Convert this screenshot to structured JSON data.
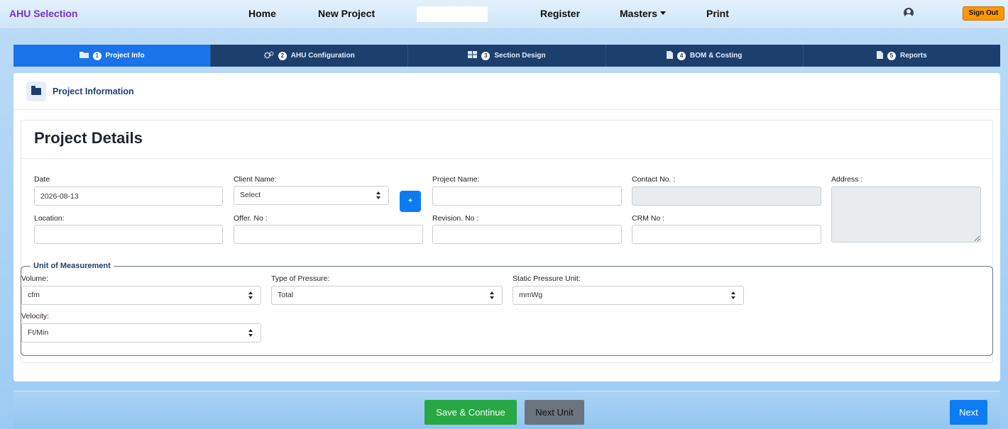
{
  "navbar": {
    "brand": "AHU Selection",
    "links": {
      "home": "Home",
      "new_project": "New Project",
      "register": "Register",
      "masters": "Masters",
      "print": "Print"
    },
    "sign_out": "Sign Out",
    "user_icon": "user-circle-icon"
  },
  "stepper": {
    "steps": [
      {
        "number": "1",
        "label": "Project Info",
        "icon": "folder-icon",
        "active": true
      },
      {
        "number": "2",
        "label": "AHU Configuration",
        "icon": "cogs-icon",
        "active": false
      },
      {
        "number": "3",
        "label": "Section Design",
        "icon": "grid-icon",
        "active": false
      },
      {
        "number": "4",
        "label": "BOM & Costing",
        "icon": "document-icon",
        "active": false
      },
      {
        "number": "5",
        "label": "Reports",
        "icon": "document-icon",
        "active": false
      }
    ]
  },
  "card": {
    "header_title": "Project Information",
    "details_title": "Project Details"
  },
  "form": {
    "date": {
      "label": "Date",
      "value": "2026-08-13"
    },
    "client_name": {
      "label": "Client Name:",
      "value": "Select"
    },
    "add_client_label": "+",
    "project_name": {
      "label": "Project Name:",
      "value": ""
    },
    "contact_no": {
      "label": "Contact No. :",
      "value": ""
    },
    "address": {
      "label": "Address :",
      "value": ""
    },
    "location": {
      "label": "Location:",
      "value": ""
    },
    "offer_no": {
      "label": "Offer. No :",
      "value": ""
    },
    "revision_no": {
      "label": "Revision. No :",
      "value": ""
    },
    "crm_no": {
      "label": "CRM No :",
      "value": ""
    }
  },
  "units": {
    "legend": "Unit of Measurement",
    "volume": {
      "label": "Volume:",
      "value": "cfm"
    },
    "pressure_type": {
      "label": "Type of Pressure:",
      "value": "Total"
    },
    "static_pressure_unit": {
      "label": "Static Pressure Unit:",
      "value": "mmWg"
    },
    "velocity": {
      "label": "Velocity:",
      "value": "Ft/Min"
    }
  },
  "footer": {
    "save_continue": "Save & Continue",
    "next_unit": "Next Unit",
    "next": "Next"
  },
  "colors": {
    "brand": "#7a2fd0",
    "stepper_bg": "#1d3f6e",
    "stepper_active": "#1a73e8",
    "sign_out": "#ff9800",
    "primary": "#0d7cf2",
    "success": "#28a745",
    "secondary": "#6c757d"
  }
}
